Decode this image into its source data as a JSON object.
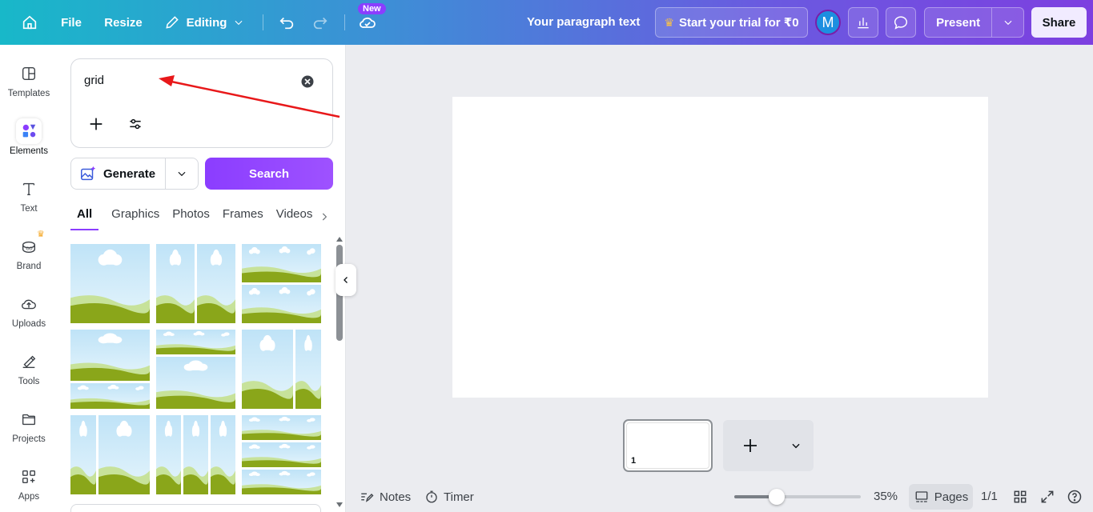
{
  "topbar": {
    "file_label": "File",
    "resize_label": "Resize",
    "editing_label": "Editing",
    "new_badge": "New",
    "doc_title": "Your paragraph text",
    "trial_label": "Start your trial for ₹0",
    "avatar_initial": "M",
    "present_label": "Present",
    "share_label": "Share"
  },
  "rail": {
    "items": [
      {
        "label": "Templates",
        "icon": "templates-icon"
      },
      {
        "label": "Elements",
        "icon": "elements-icon"
      },
      {
        "label": "Text",
        "icon": "text-icon"
      },
      {
        "label": "Brand",
        "icon": "brand-icon"
      },
      {
        "label": "Uploads",
        "icon": "uploads-icon"
      },
      {
        "label": "Tools",
        "icon": "tools-icon"
      },
      {
        "label": "Projects",
        "icon": "projects-icon"
      },
      {
        "label": "Apps",
        "icon": "apps-icon"
      }
    ]
  },
  "panel": {
    "search_value": "grid",
    "generate_label": "Generate",
    "search_button": "Search",
    "tabs": [
      "All",
      "Graphics",
      "Photos",
      "Frames",
      "Videos"
    ]
  },
  "pages": {
    "current_page_number": "1"
  },
  "bottom": {
    "notes_label": "Notes",
    "timer_label": "Timer",
    "zoom_level": "35%",
    "pages_label": "Pages",
    "page_count": "1/1"
  },
  "colors": {
    "accent": "#8b3dff",
    "annotation_arrow": "#e8181a"
  }
}
